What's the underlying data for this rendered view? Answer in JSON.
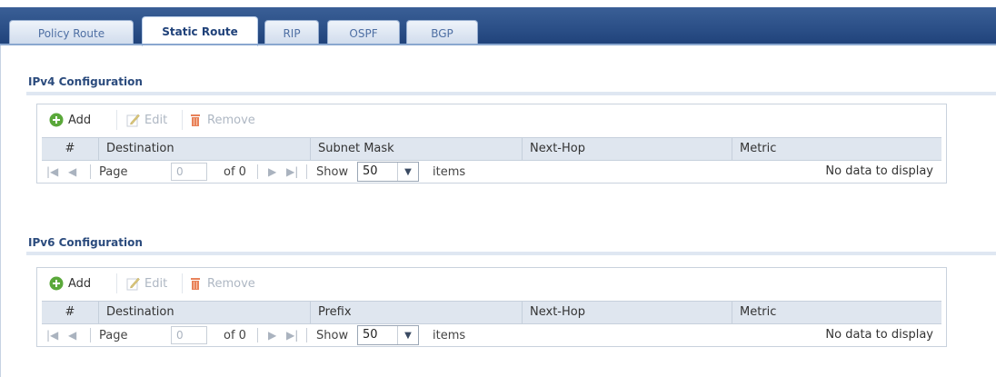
{
  "tabs": [
    "Policy Route",
    "Static Route",
    "RIP",
    "OSPF",
    "BGP"
  ],
  "active_tab": "Static Route",
  "toolbar": {
    "add": "Add",
    "edit": "Edit",
    "remove": "Remove"
  },
  "pager": {
    "page_label": "Page",
    "page_value": "0",
    "of_label": "of 0",
    "show_label": "Show",
    "show_value": "50",
    "items_label": "items",
    "empty_text": "No data to display"
  },
  "ipv4": {
    "title": "IPv4 Configuration",
    "columns": [
      "#",
      "Destination",
      "Subnet Mask",
      "Next-Hop",
      "Metric"
    ]
  },
  "ipv6": {
    "title": "IPv6 Configuration",
    "columns": [
      "#",
      "Destination",
      "Prefix",
      "Next-Hop",
      "Metric"
    ]
  },
  "colors": {
    "tabbar": "#2a4e86",
    "header": "#dfe6ef",
    "add_icon": "#5aa83a",
    "remove_icon": "#e8825a"
  },
  "icons": [
    "add-icon",
    "edit-icon",
    "remove-icon",
    "first-page-icon",
    "prev-page-icon",
    "next-page-icon",
    "last-page-icon",
    "dropdown-arrow-icon"
  ]
}
